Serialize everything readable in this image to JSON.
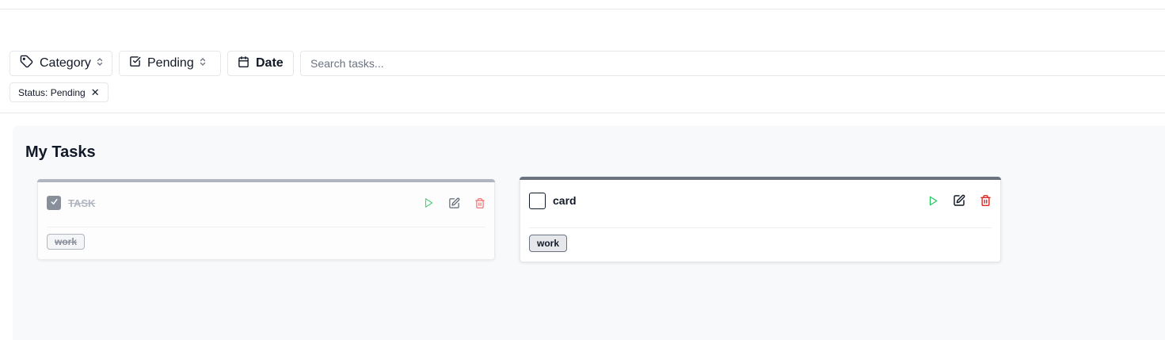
{
  "filters": {
    "category_label": "Category",
    "status_label": "Pending",
    "date_label": "Date",
    "search_placeholder": "Search tasks..."
  },
  "active_filter_chip": {
    "label": "Status: Pending",
    "remove_glyph": "✕"
  },
  "board": {
    "title": "My Tasks",
    "tasks": [
      {
        "title": "TASK",
        "completed": true,
        "tag": "work",
        "icons": [
          "check-icon",
          "play-icon",
          "edit-icon",
          "trash-icon"
        ]
      },
      {
        "title": "card",
        "completed": false,
        "tag": "work",
        "icons": [
          "play-icon",
          "edit-icon",
          "trash-icon"
        ]
      }
    ]
  },
  "colors": {
    "play": "#22c55e",
    "delete": "#ef4444",
    "accent_bar": "#6b7280",
    "panel_bg": "#f8f9fb"
  }
}
